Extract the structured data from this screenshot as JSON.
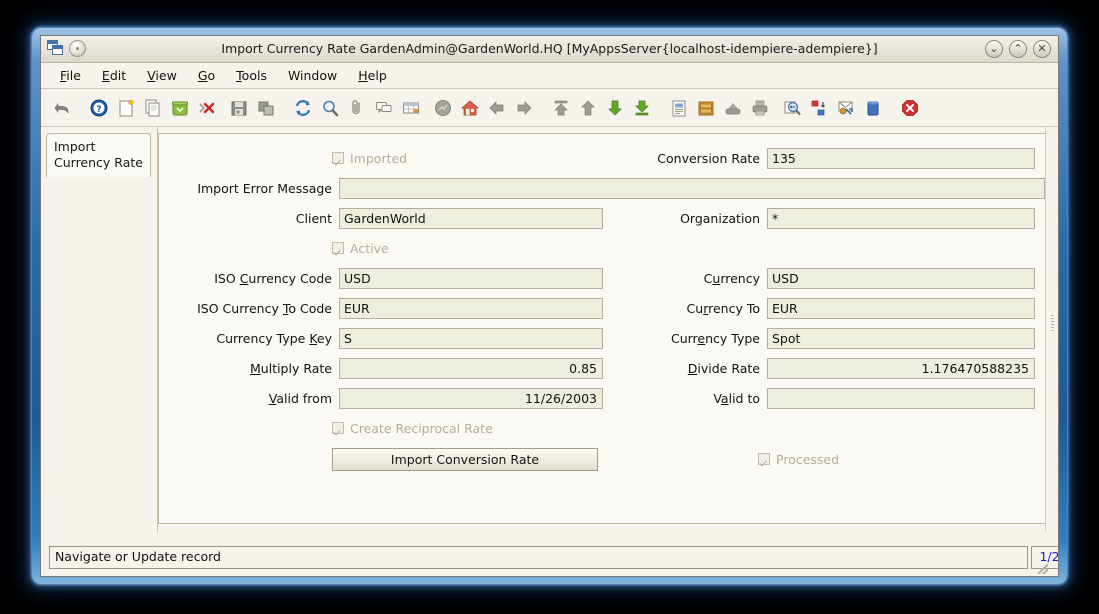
{
  "window": {
    "title": "Import Currency Rate  GardenAdmin@GardenWorld.HQ [MyAppsServer{localhost-idempiere-adempiere}]",
    "minimize_label": "⌄",
    "maximize_label": "⌃",
    "close_label": "✕"
  },
  "menubar": {
    "items": [
      {
        "label": "File",
        "mnemonic": "F"
      },
      {
        "label": "Edit",
        "mnemonic": "E"
      },
      {
        "label": "View",
        "mnemonic": "V"
      },
      {
        "label": "Go",
        "mnemonic": "G"
      },
      {
        "label": "Tools",
        "mnemonic": "T"
      },
      {
        "label": "Window",
        "mnemonic": ""
      },
      {
        "label": "Help",
        "mnemonic": "H"
      }
    ]
  },
  "toolbar": {
    "buttons": [
      {
        "name": "undo-icon"
      },
      {
        "name": "help-icon"
      },
      {
        "name": "new-record-icon"
      },
      {
        "name": "copy-record-icon"
      },
      {
        "name": "delete-record-icon"
      },
      {
        "name": "delete-selection-icon"
      },
      {
        "name": "save-icon"
      },
      {
        "name": "save-and-create-icon"
      },
      {
        "name": "refresh-icon"
      },
      {
        "name": "find-icon"
      },
      {
        "name": "attachment-icon"
      },
      {
        "name": "chat-icon"
      },
      {
        "name": "grid-toggle-icon"
      },
      {
        "name": "history-icon"
      },
      {
        "name": "home-icon"
      },
      {
        "name": "previous-record-icon"
      },
      {
        "name": "next-record-icon"
      },
      {
        "name": "first-record-icon"
      },
      {
        "name": "previous-page-icon"
      },
      {
        "name": "next-page-icon"
      },
      {
        "name": "last-record-icon"
      },
      {
        "name": "report-icon"
      },
      {
        "name": "archive-icon"
      },
      {
        "name": "print-preview-icon"
      },
      {
        "name": "print-icon"
      },
      {
        "name": "zoom-across-icon"
      },
      {
        "name": "active-workflow-icon"
      },
      {
        "name": "requests-icon"
      },
      {
        "name": "product-info-icon"
      },
      {
        "name": "exit-icon"
      }
    ]
  },
  "tabs": {
    "active": "Import\nCurrency Rate",
    "active_line1": "Import",
    "active_line2": "Currency Rate"
  },
  "form": {
    "rows": [
      {
        "left": {
          "type": "checkbox",
          "label": "Imported",
          "checked": true,
          "disabled": true
        },
        "right": {
          "type": "field",
          "label": "Conversion Rate",
          "value": "135",
          "align": "left"
        }
      },
      {
        "left": {
          "type": "field",
          "label": "Import Error Message",
          "value": "",
          "align": "left",
          "wide": true
        },
        "right": {
          "type": "none"
        }
      },
      {
        "left": {
          "type": "field",
          "label": "Client",
          "value": "GardenWorld",
          "align": "left"
        },
        "right": {
          "type": "field",
          "label": "Organization",
          "value": "*",
          "align": "left"
        }
      },
      {
        "left": {
          "type": "checkbox",
          "label": "Active",
          "checked": true,
          "disabled": true
        },
        "right": {
          "type": "none"
        }
      },
      {
        "left": {
          "type": "field",
          "label": "ISO Currency Code",
          "mnemonic": "C",
          "value": "USD",
          "align": "left"
        },
        "right": {
          "type": "field",
          "label": "Currency",
          "mnemonic": "u",
          "value": "USD",
          "align": "left"
        }
      },
      {
        "left": {
          "type": "field",
          "label": "ISO Currency To Code",
          "mnemonic": "T",
          "value": "EUR",
          "align": "left"
        },
        "right": {
          "type": "field",
          "label": "Currency To",
          "mnemonic": "r",
          "value": "EUR",
          "align": "left"
        }
      },
      {
        "left": {
          "type": "field",
          "label": "Currency Type Key",
          "mnemonic": "K",
          "value": "S",
          "align": "left"
        },
        "right": {
          "type": "field",
          "label": "Currency Type",
          "mnemonic": "e",
          "value": "Spot",
          "align": "left"
        }
      },
      {
        "left": {
          "type": "field",
          "label": "Multiply Rate",
          "mnemonic": "M",
          "value": "0.85",
          "align": "right"
        },
        "right": {
          "type": "field",
          "label": "Divide Rate",
          "mnemonic": "D",
          "value": "1.176470588235",
          "align": "right"
        }
      },
      {
        "left": {
          "type": "field",
          "label": "Valid from",
          "mnemonic": "V",
          "value": "11/26/2003",
          "align": "right"
        },
        "right": {
          "type": "field",
          "label": "Valid to",
          "mnemonic": "a",
          "value": "",
          "align": "right"
        }
      },
      {
        "left": {
          "type": "checkbox",
          "label": "Create Reciprocal Rate",
          "checked": true,
          "disabled": true
        },
        "right": {
          "type": "none"
        }
      },
      {
        "left": {
          "type": "button",
          "label": "Import Conversion Rate"
        },
        "right": {
          "type": "checkbox",
          "label": "Processed",
          "checked": true,
          "disabled": true
        }
      }
    ]
  },
  "statusbar": {
    "message": "Navigate or Update record",
    "record_count": "1/2"
  },
  "colors": {
    "window_border": "#2a6cab",
    "panel_bg": "#f6f3ec",
    "field_bg": "#edeede",
    "field_border": "#b4ae9b",
    "tab_border": "#c2b79d",
    "text": "#14130f",
    "disabled_text": "#b6ae9b",
    "count_text": "#1a1ad0"
  }
}
